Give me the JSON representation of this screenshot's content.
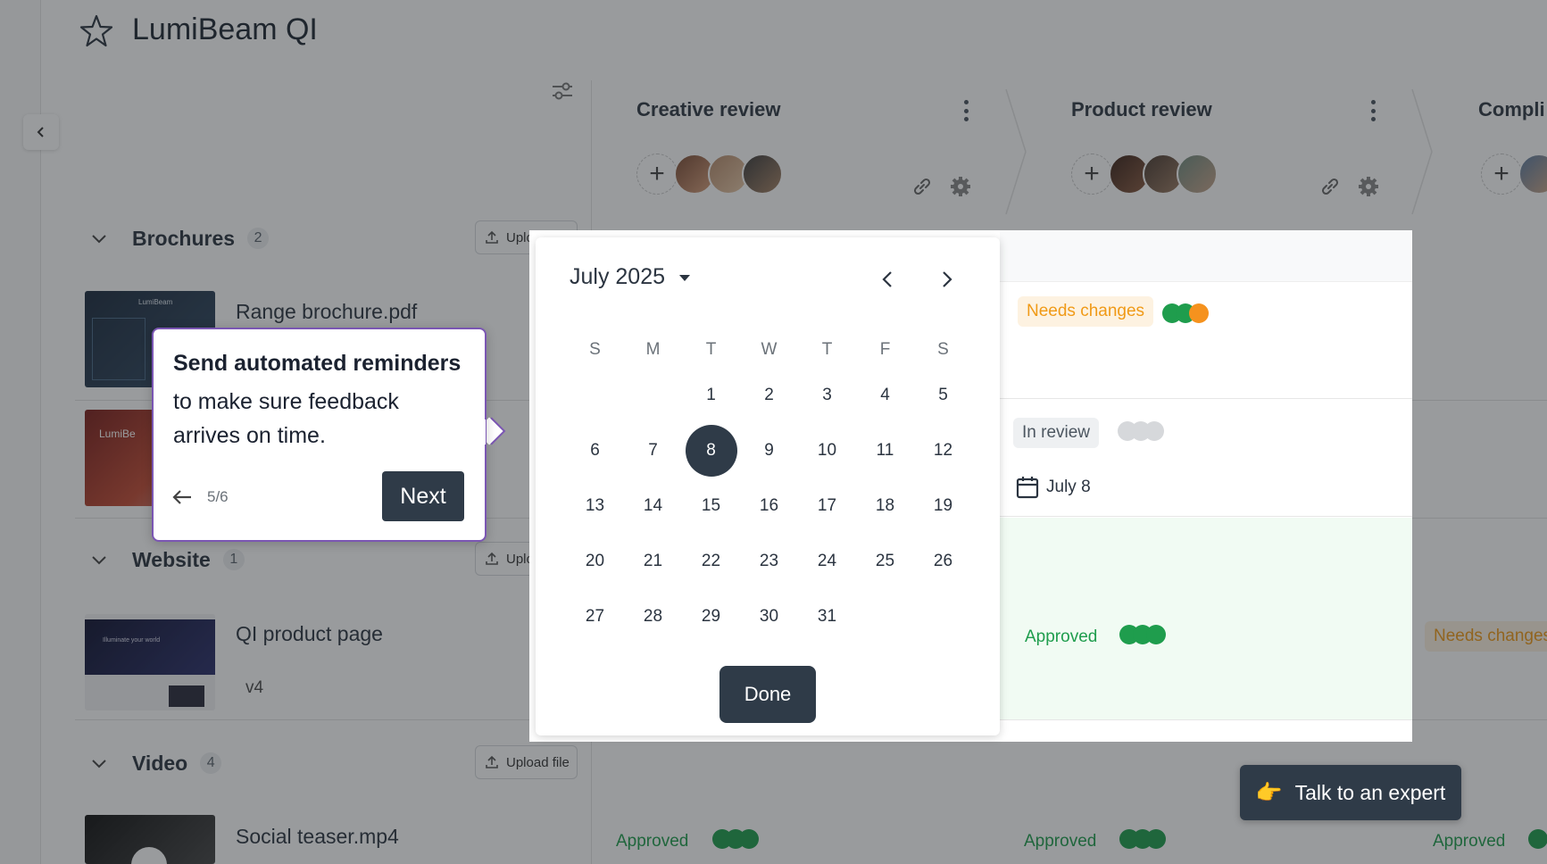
{
  "header": {
    "title": "LumiBeam QI"
  },
  "stages": [
    {
      "title": "Creative review"
    },
    {
      "title": "Product review"
    },
    {
      "title": "Compli"
    }
  ],
  "groups": [
    {
      "name": "Brochures",
      "count": "2",
      "upload_label": "Upload file"
    },
    {
      "name": "Website",
      "count": "1",
      "upload_label": "Upload file"
    },
    {
      "name": "Video",
      "count": "4",
      "upload_label": "Upload file"
    }
  ],
  "assets": [
    {
      "name": "Range brochure.pdf",
      "thumb_text": "LumiBeam"
    },
    {
      "name": "",
      "thumb_text": "LumiBe"
    },
    {
      "name": "QI product page",
      "version": "v4",
      "thumb_text": "Illuminate your world"
    },
    {
      "name": "Social teaser.mp4"
    }
  ],
  "statuses": {
    "range_product": "Needs changes",
    "row2_product": "In review",
    "row2_due": "July 8",
    "web_product": "Approved",
    "web_compliance": "Needs changes",
    "video_creative": "Approved",
    "video_product": "Approved",
    "video_compliance": "Approved"
  },
  "calendar": {
    "month_label": "July 2025",
    "weekdays": [
      "S",
      "M",
      "T",
      "W",
      "T",
      "F",
      "S"
    ],
    "leading_blanks": 2,
    "days": [
      "1",
      "2",
      "3",
      "4",
      "5",
      "6",
      "7",
      "8",
      "9",
      "10",
      "11",
      "12",
      "13",
      "14",
      "15",
      "16",
      "17",
      "18",
      "19",
      "20",
      "21",
      "22",
      "23",
      "24",
      "25",
      "26",
      "27",
      "28",
      "29",
      "30",
      "31"
    ],
    "selected_day": "8",
    "done_label": "Done"
  },
  "tooltip": {
    "title": "Send automated reminders",
    "body": "to make sure feedback arrives on time.",
    "step": "5/6",
    "next_label": "Next"
  },
  "help": {
    "label": "Talk to an expert"
  },
  "colors": {
    "accent_dark": "#2f3b48",
    "approved": "#1f9d4d",
    "needs_changes": "#f09a17",
    "tooltip_border": "#7b56b3"
  },
  "icons": {
    "favorite": "star-icon",
    "collapse": "chevron-left-icon",
    "filter": "sliders-icon",
    "link": "link-icon",
    "settings": "gear-icon",
    "upload": "upload-icon",
    "date": "calendar-icon",
    "help": "pointing-hand-icon"
  }
}
